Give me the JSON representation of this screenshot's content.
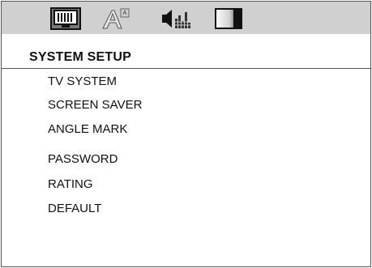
{
  "header": {
    "tabs": [
      {
        "icon": "monitor-icon",
        "selected": true
      },
      {
        "icon": "language-icon",
        "selected": false
      },
      {
        "icon": "audio-speaker-icon",
        "selected": false
      },
      {
        "icon": "video-contrast-icon",
        "selected": false
      }
    ],
    "bar_color": "#d0d0d0"
  },
  "page": {
    "title": "SYSTEM SETUP"
  },
  "menu": {
    "items": [
      {
        "label": "TV SYSTEM"
      },
      {
        "label": "SCREEN SAVER"
      },
      {
        "label": "ANGLE MARK"
      },
      {
        "label": "PASSWORD"
      },
      {
        "label": "RATING"
      },
      {
        "label": "DEFAULT"
      }
    ]
  }
}
